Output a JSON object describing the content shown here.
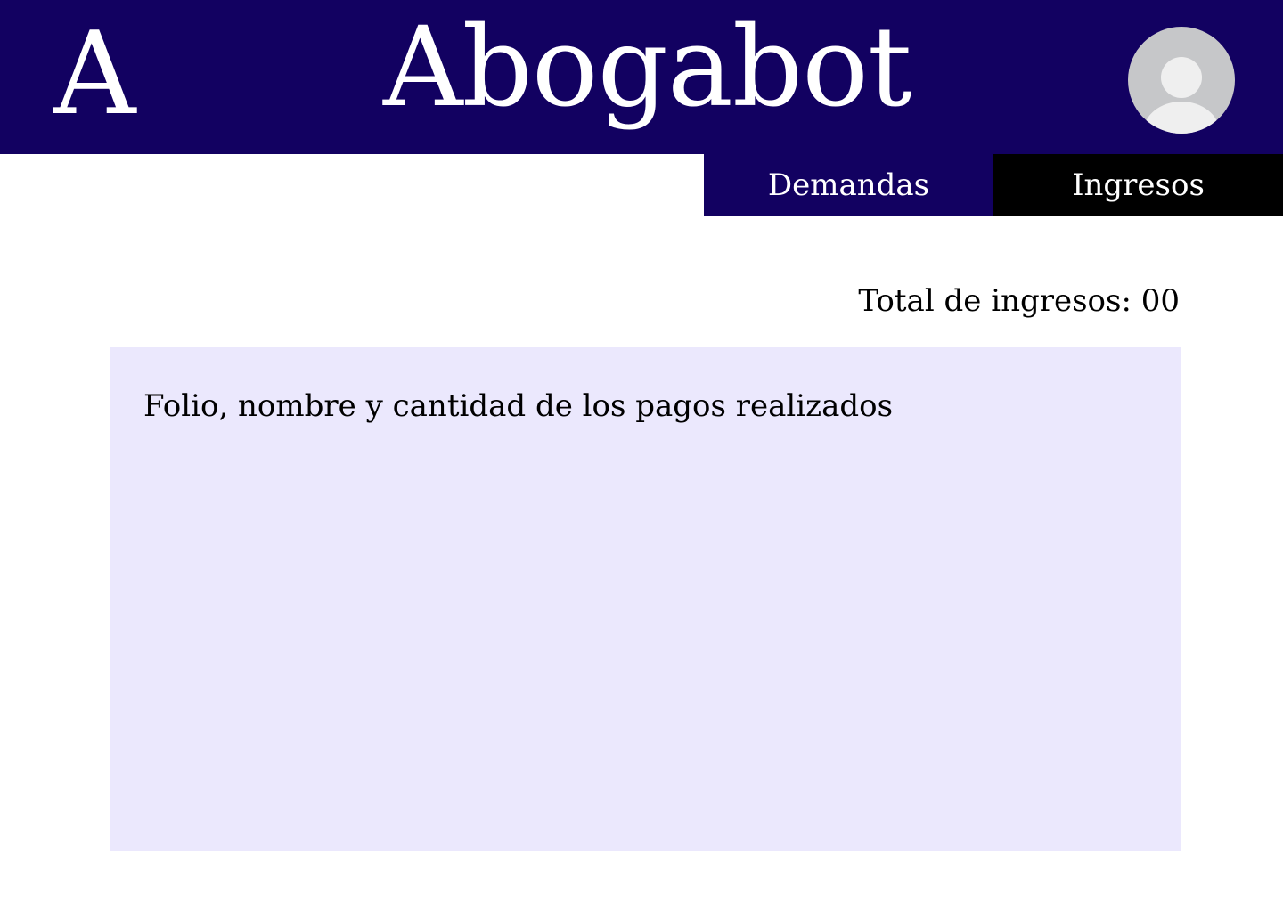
{
  "header": {
    "logo_letter": "A",
    "app_title": "Abogabot",
    "background_color": "#120161",
    "avatar_icon": "user-avatar-icon"
  },
  "nav": {
    "tabs": [
      {
        "label": "Demandas",
        "active": false,
        "color": "#120161"
      },
      {
        "label": "Ingresos",
        "active": true,
        "color": "#000000"
      }
    ]
  },
  "main": {
    "total_label": "Total de ingresos: 00",
    "panel": {
      "text": "Folio, nombre y cantidad de los pagos realizados",
      "background_color": "#ebe8fd"
    }
  }
}
